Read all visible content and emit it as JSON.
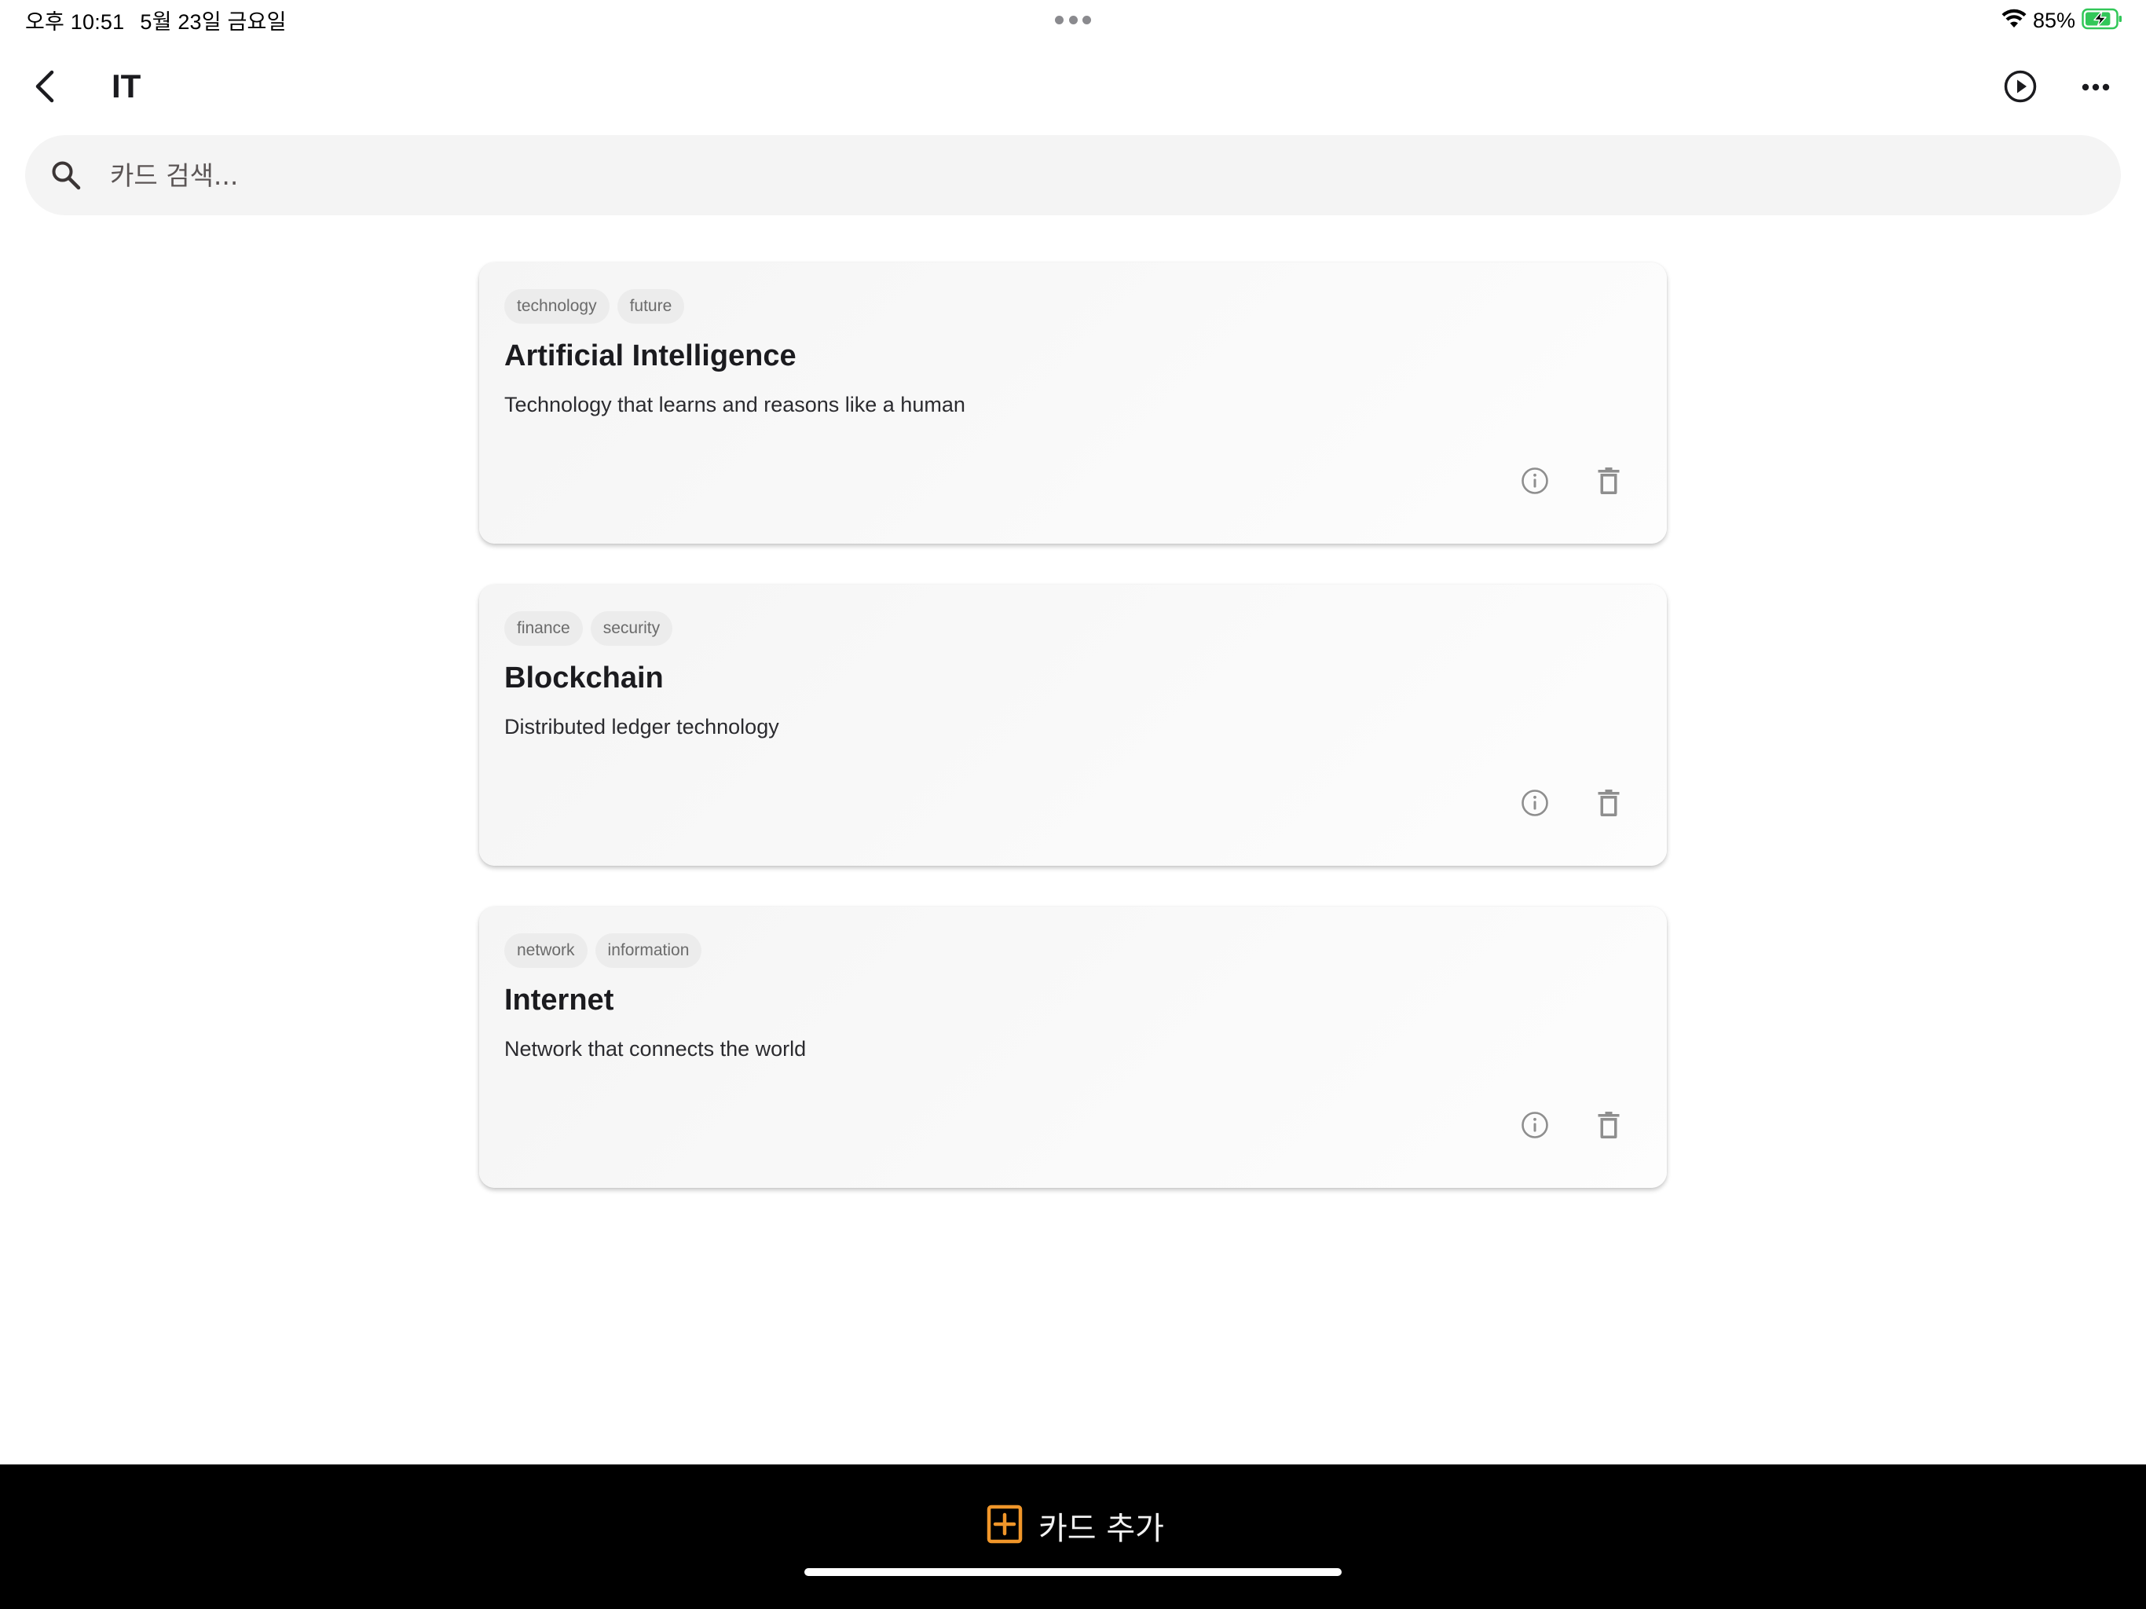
{
  "status_bar": {
    "time": "오후 10:51",
    "date": "5월 23일 금요일",
    "battery_percent": "85%",
    "battery_level": 0.85,
    "charging": true,
    "icons": [
      "wifi-icon",
      "battery-charging-icon"
    ]
  },
  "app_bar": {
    "title": "IT",
    "icons": [
      "back-arrow-icon",
      "play-circle-icon",
      "more-horizontal-icon"
    ]
  },
  "search": {
    "placeholder": "카드 검색...",
    "value": "",
    "icon": "search-icon"
  },
  "cards": [
    {
      "tags": [
        "technology",
        "future"
      ],
      "title": "Artificial Intelligence",
      "description": "Technology that learns and reasons like a human"
    },
    {
      "tags": [
        "finance",
        "security"
      ],
      "title": "Blockchain",
      "description": "Distributed ledger technology"
    },
    {
      "tags": [
        "network",
        "information"
      ],
      "title": "Internet",
      "description": "Network that connects the world"
    }
  ],
  "card_actions": {
    "icons": [
      "info-icon",
      "delete-icon"
    ]
  },
  "bottom_bar": {
    "add_card_label": "카드 추가",
    "icon": "add-box-icon"
  },
  "colors": {
    "accent": "#f0962a",
    "background": "#ffffff",
    "bottom_bar": "#000000",
    "battery_green": "#32c759",
    "search_bg": "#f4f4f4",
    "tag_bg": "#ececec"
  }
}
